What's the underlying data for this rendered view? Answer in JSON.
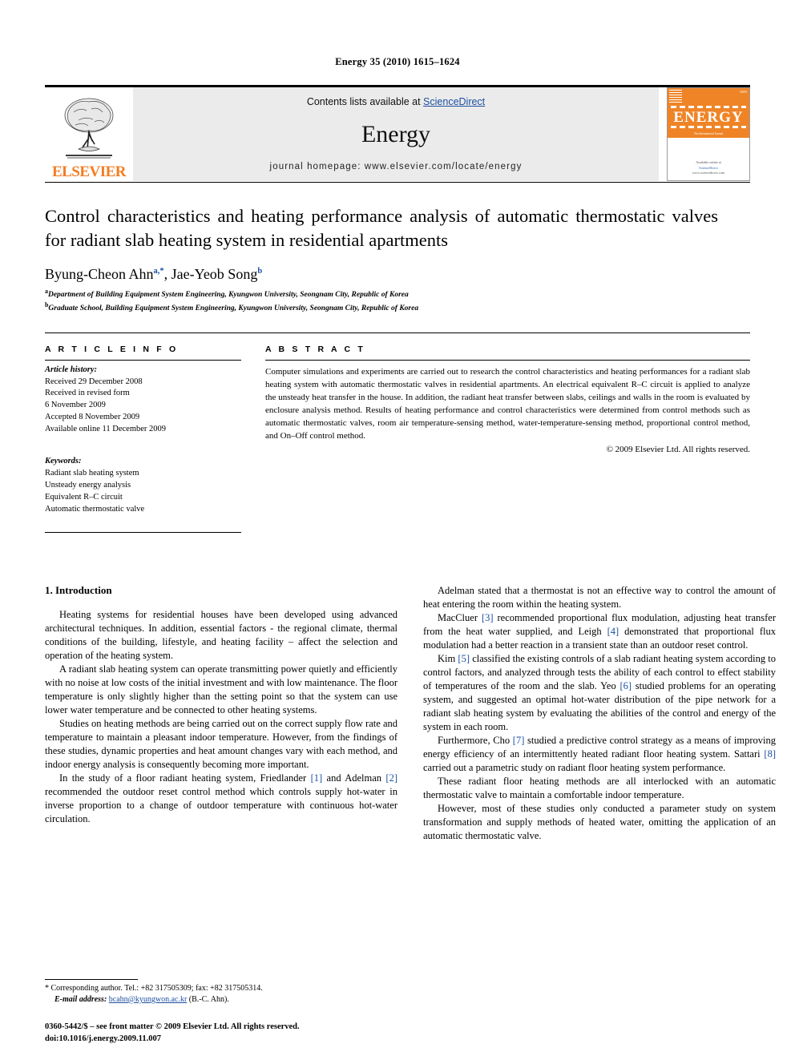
{
  "running_head": "Energy 35 (2010) 1615–1624",
  "masthead": {
    "publisher_logo_text": "ELSEVIER",
    "contents_prefix": "Contents lists available at ",
    "contents_link": "ScienceDirect",
    "journal_name": "Energy",
    "homepage": "journal homepage: www.elsevier.com/locate/energy",
    "cover": {
      "title": "ENERGY",
      "issue_code": "ISSN",
      "footer_line1": "Available online at",
      "footer_line2": "ScienceDirect",
      "footer_line3": "www.sciencedirect.com",
      "subtitle": "The International Journal"
    }
  },
  "article": {
    "title": "Control characteristics and heating performance analysis of automatic thermostatic valves for radiant slab heating system in residential apartments",
    "authors": [
      {
        "name": "Byung-Cheon Ahn",
        "sup": "a,*"
      },
      {
        "name": "Jae-Yeob Song",
        "sup": "b"
      }
    ],
    "affiliations": [
      {
        "label": "a",
        "text": "Department of Building Equipment System Engineering, Kyungwon University, Seongnam City, Republic of Korea"
      },
      {
        "label": "b",
        "text": "Graduate School, Building Equipment System Engineering, Kyungwon University, Seongnam City, Republic of Korea"
      }
    ]
  },
  "article_info": {
    "heading": "A R T I C L E  I N F O",
    "history_label": "Article history:",
    "history": [
      "Received 29 December 2008",
      "Received in revised form",
      "6 November 2009",
      "Accepted 8 November 2009",
      "Available online 11 December 2009"
    ],
    "keywords_label": "Keywords:",
    "keywords": [
      "Radiant slab heating system",
      "Unsteady energy analysis",
      "Equivalent R–C circuit",
      "Automatic thermostatic valve"
    ]
  },
  "abstract": {
    "heading": "A B S T R A C T",
    "text": "Computer simulations and experiments are carried out to research the control characteristics and heating performances for a radiant slab heating system with automatic thermostatic valves in residential apartments. An electrical equivalent R–C circuit is applied to analyze the unsteady heat transfer in the house. In addition, the radiant heat transfer between slabs, ceilings and walls in the room is evaluated by enclosure analysis method. Results of heating performance and control characteristics were determined from control methods such as automatic thermostatic valves, room air temperature-sensing method, water-temperature-sensing method, proportional control method, and On–Off control method.",
    "copyright": "© 2009 Elsevier Ltd. All rights reserved."
  },
  "body": {
    "section_title": "1.  Introduction",
    "left_paragraphs": [
      "Heating systems for residential houses have been developed using advanced architectural techniques. In addition, essential factors - the regional climate, thermal conditions of the building, lifestyle, and heating facility – affect the selection and operation of the heating system.",
      "A radiant slab heating system can operate transmitting power quietly and efficiently with no noise at low costs of the initial investment and with low maintenance. The floor temperature is only slightly higher than the setting point so that the system can use lower water temperature and be connected to other heating systems.",
      "Studies on heating methods are being carried out on the correct supply flow rate and temperature to maintain a pleasant indoor temperature. However, from the findings of these studies, dynamic properties and heat amount changes vary with each method, and indoor energy analysis is consequently becoming more important.",
      "In the study of a floor radiant heating system, Friedlander [1] and Adelman [2] recommended the outdoor reset control method which controls supply hot-water in inverse proportion to a change of outdoor temperature with continuous hot-water circulation."
    ],
    "right_paragraphs": [
      "Adelman stated that a thermostat is not an effective way to control the amount of heat entering the room within the heating system.",
      "MacCluer [3] recommended proportional flux modulation, adjusting heat transfer from the heat water supplied, and Leigh [4] demonstrated that proportional flux modulation had a better reaction in a transient state than an outdoor reset control.",
      "Kim [5] classified the existing controls of a slab radiant heating system according to control factors, and analyzed through tests the ability of each control to effect stability of temperatures of the room and the slab. Yeo [6] studied problems for an operating system, and suggested an optimal hot-water distribution of the pipe network for a radiant slab heating system by evaluating the abilities of the control and energy of the system in each room.",
      "Furthermore, Cho [7] studied a predictive control strategy as a means of improving energy efficiency of an intermittently heated radiant floor heating system. Sattari [8] carried out a parametric study on radiant floor heating system performance.",
      "These radiant floor heating methods are all interlocked with an automatic thermostatic valve to maintain a comfortable indoor temperature.",
      "However, most of these studies only conducted a parameter study on system transformation and supply methods of heated water, omitting the application of an automatic thermostatic valve."
    ]
  },
  "footnotes": {
    "corresponding": "* Corresponding author. Tel.: +82 317505309; fax: +82 317505314.",
    "email_label": "E-mail address:",
    "email": "bcahn@kyungwon.ac.kr",
    "email_suffix": "(B.-C. Ahn)."
  },
  "imprint": {
    "line1": "0360-5442/$ – see front matter © 2009 Elsevier Ltd. All rights reserved.",
    "line2": "doi:10.1016/j.energy.2009.11.007"
  },
  "colors": {
    "link_blue": "#1d4fa0",
    "elsevier_orange": "#F47C20",
    "masthead_gray": "#ebebeb"
  }
}
